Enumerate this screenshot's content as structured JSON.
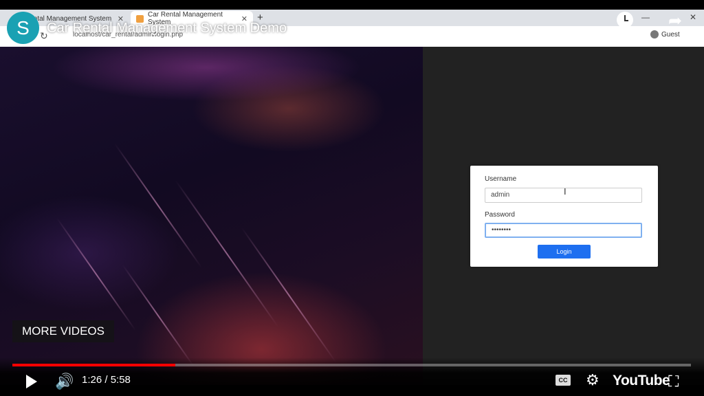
{
  "browser": {
    "tabs": [
      {
        "label": "Rental Management System"
      },
      {
        "label": "Car Rental Management System"
      }
    ],
    "url": "localhost/car_rental/admin/login.php",
    "profile": "Guest"
  },
  "login_form": {
    "username_label": "Username",
    "username_value": "admin",
    "password_label": "Password",
    "password_value": "••••••••",
    "login_button": "Login"
  },
  "youtube": {
    "channel_initial": "S",
    "title": "Car Rental Management System Demo",
    "watch_later": "Watch later",
    "share": "Share",
    "more_videos": "MORE VIDEOS",
    "time": "1:26 / 5:58",
    "progress_fraction": 0.24,
    "cc": "CC",
    "logo": "YouTube",
    "accent": "#ff0000"
  }
}
